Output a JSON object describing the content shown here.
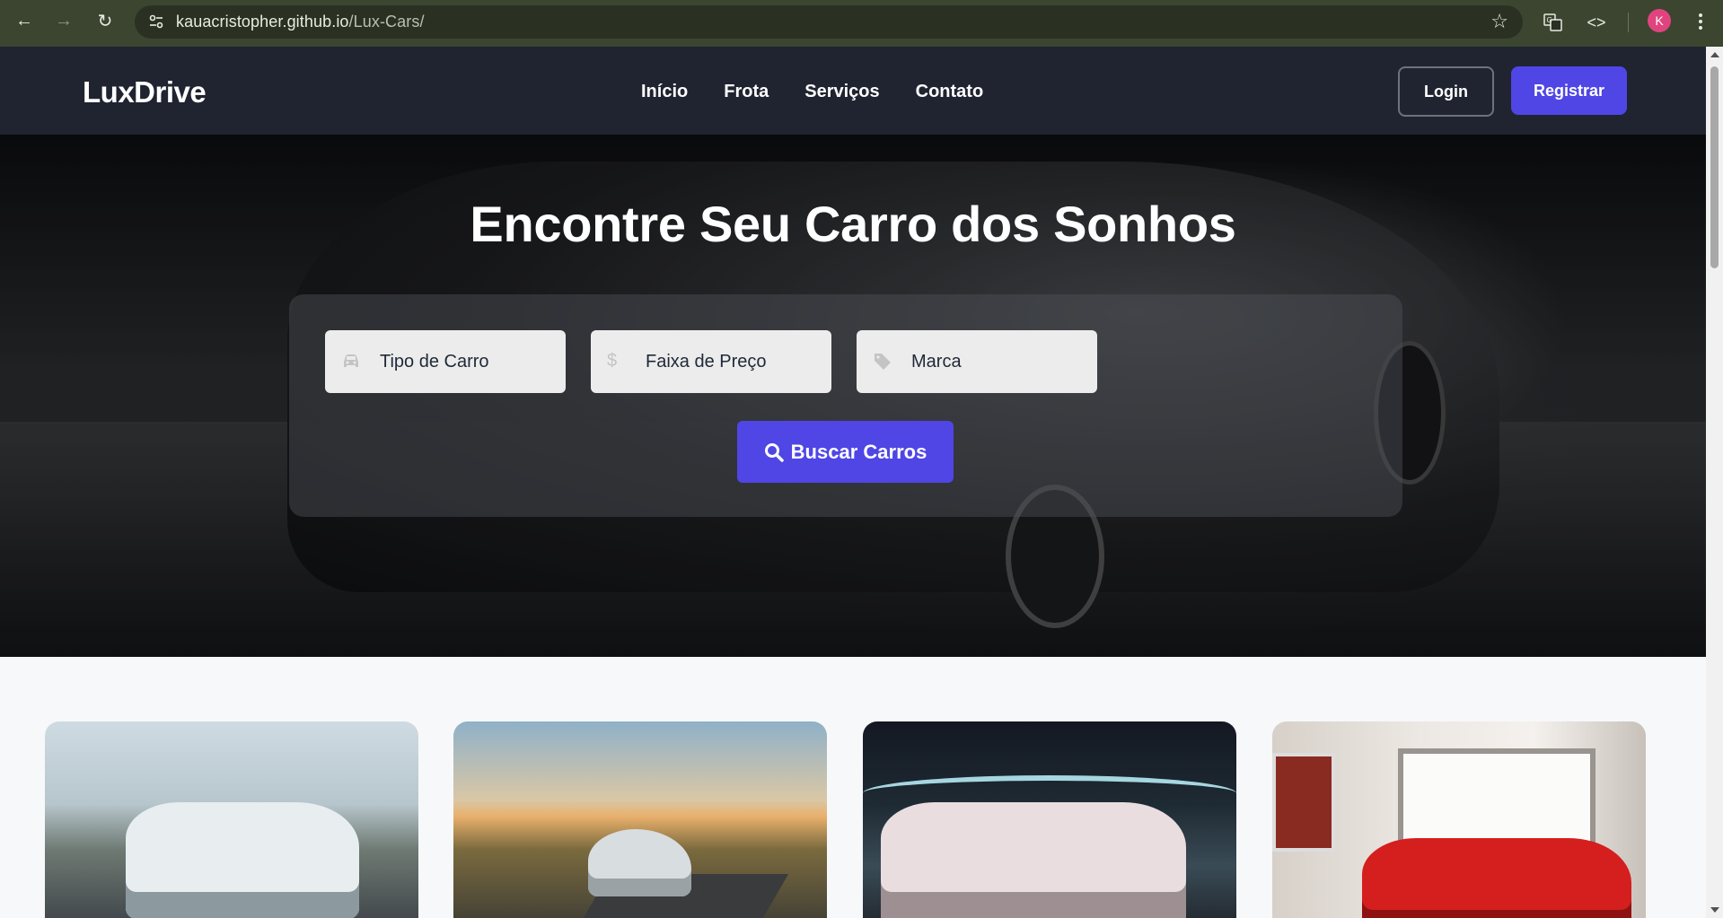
{
  "browser": {
    "url_host": "kauacristopher.github.io",
    "url_path": "/Lux-Cars/",
    "avatar_letter": "K",
    "icons": [
      "back-arrow-icon",
      "forward-arrow-icon",
      "reload-icon",
      "site-info-icon",
      "star-icon",
      "translate-icon",
      "code-icon",
      "menu-dots-icon"
    ]
  },
  "header": {
    "logo": "LuxDrive",
    "nav": [
      "Início",
      "Frota",
      "Serviços",
      "Contato"
    ],
    "login_label": "Login",
    "register_label": "Registrar"
  },
  "hero": {
    "title": "Encontre Seu Carro dos Sonhos",
    "fields": [
      {
        "label": "Tipo de Carro",
        "icon": "car-icon"
      },
      {
        "label": "Faixa de Preço",
        "icon": "dollar-icon"
      },
      {
        "label": "Marca",
        "icon": "tag-icon"
      }
    ],
    "search_button": "Buscar Carros"
  },
  "cards": [
    {
      "image": "white-sedan-street-palms"
    },
    {
      "image": "silver-sportscar-road-sunset"
    },
    {
      "image": "white-sedan-light-trails"
    },
    {
      "image": "red-supercar-showroom"
    }
  ],
  "colors": {
    "accent": "#4f46e5",
    "header_bg": "#1f2430",
    "browser_bar": "#3b4530"
  }
}
